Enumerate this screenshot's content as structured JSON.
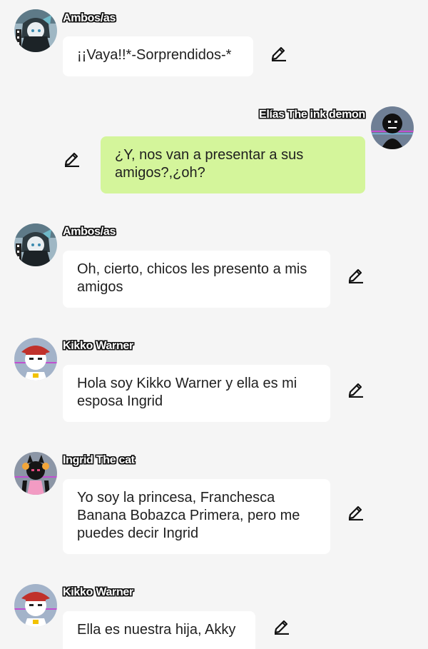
{
  "messages": [
    {
      "name": "Ambos/as",
      "text": "¡¡Vaya!!*-Sorprendidos-*",
      "side": "left",
      "avatar": "ambos-avatar",
      "icon": "pen-icon"
    },
    {
      "name": "Elías The ink demon",
      "text": "¿Y, nos van a presentar a sus amigos?,¿oh?",
      "side": "right",
      "avatar": "elias-avatar",
      "icon": "pen-icon",
      "bubble_color": "#d4f59b"
    },
    {
      "name": "Ambos/as",
      "text": "Oh, cierto, chicos les presento a mis amigos",
      "side": "left",
      "avatar": "ambos-avatar",
      "icon": "pen-icon"
    },
    {
      "name": "Kikko Warner",
      "text": "Hola soy Kikko Warner y ella es mi esposa Ingrid",
      "side": "left",
      "avatar": "kikko-avatar",
      "icon": "pen-icon"
    },
    {
      "name": "Ingrid The cat",
      "text": "Yo soy la princesa, Franchesca Banana Bobazca Primera, pero me puedes decir Ingrid",
      "side": "left",
      "avatar": "ingrid-avatar",
      "icon": "pen-icon"
    },
    {
      "name": "Kikko Warner",
      "text": "Ella es nuestra hija, Akky",
      "side": "left",
      "avatar": "kikko-avatar",
      "icon": "pen-icon"
    }
  ]
}
